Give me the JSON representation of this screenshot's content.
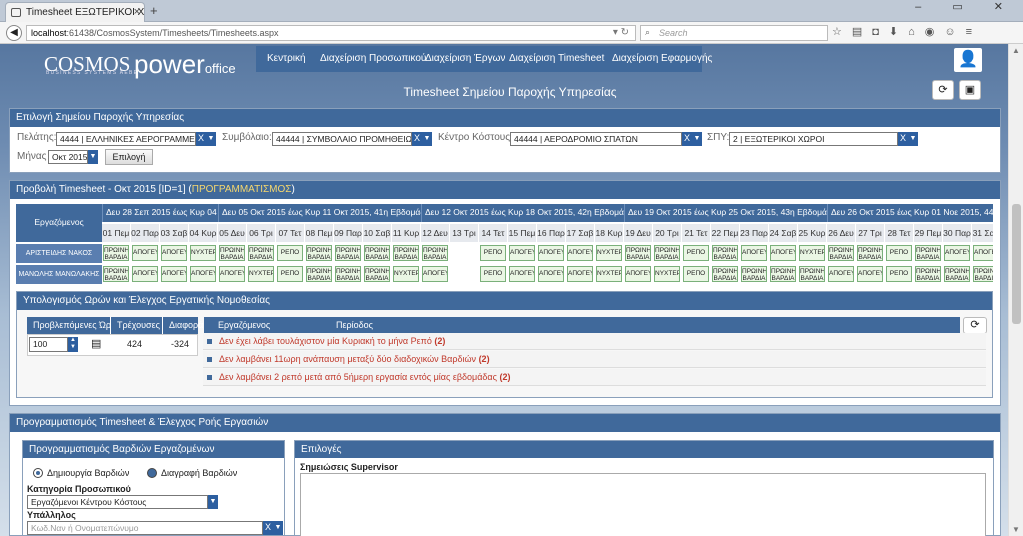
{
  "browser": {
    "tab_title": "Timesheet ΕΞΩΤΕΡΙΚΟΙ ΧΩ...",
    "new_tab": "+",
    "url_host": "localhost",
    "url_rest": ":61438/CosmosSystem/Timesheets/Timesheets.aspx",
    "search_placeholder": "Search",
    "window_controls": "– ▭ ✕",
    "toolbar_icons": [
      "star-icon",
      "reading-list-icon",
      "pocket-icon",
      "download-icon",
      "home-icon",
      "chat-icon",
      "sync-icon",
      "user-icon",
      "menu-icon"
    ]
  },
  "header": {
    "logo_main": "COSMOS",
    "logo_sub": "BUSINESS SYSTEMS AEBE",
    "logo_power": "power",
    "logo_office": "office",
    "menu": [
      "Κεντρική",
      "Διαχείριση Προσωπικού",
      "Διαχείριση Έργων",
      "Διαχείριση Timesheet",
      "Διαχείριση Εφαρμογής"
    ],
    "page_title": "Timesheet Σημείου Παροχής Υπηρεσίας"
  },
  "selection": {
    "title": "Επιλογή Σημείου Παροχής Υπηρεσίας",
    "client_label": "Πελάτης:",
    "client_value": "4444 | ΕΛΛΗΝΙΚΕΣ ΑΕΡΟΓΡΑΜΜΕΣ",
    "contract_label": "Συμβόλαιο:",
    "contract_value": "44444 | ΣΥΜΒΟΛΑΙΟ ΠΡΟΜΗΘΕΙΩΝ",
    "costcenter_label": "Κέντρο Κόστους:",
    "costcenter_value": "44444 | ΑΕΡΟΔΡΟΜΙΟ ΣΠΑΤΩΝ",
    "spy_label": "ΣΠΥ:",
    "spy_value": "2 | ΕΞΩΤΕΡΙΚΟΙ ΧΩΡΟΙ",
    "month_label": "Μήνας",
    "month_value": "Οκτ 2015",
    "select_button": "Επιλογή",
    "x": "X"
  },
  "timesheet": {
    "title_prefix": "Προβολή Timesheet - Οκτ 2015 [ID=1] (",
    "title_status": "ΠΡΟΓΡΑΜΜΑΤΙΣΜΟΣ",
    "title_suffix": ")",
    "employee_header": "Εργαζόμενος",
    "weeks": [
      "Δευ 28 Σεπ 2015 έως Κυρ 04 Οκτ",
      "Δευ 05 Οκτ 2015 έως Κυρ 11 Οκτ 2015, 41η Εβδομάδα",
      "Δευ 12 Οκτ 2015 έως Κυρ 18 Οκτ 2015, 42η Εβδομάδα",
      "Δευ 19 Οκτ 2015 έως Κυρ 25 Οκτ 2015, 43η Εβδομάδα",
      "Δευ 26 Οκτ 2015 έως Κυρ 01 Νοε 2015, 44η Εβδ"
    ],
    "days": [
      "01 Πεμ",
      "02 Παρ",
      "03 Σαβ",
      "04 Κυρ",
      "05 Δευ",
      "06 Τρι",
      "07 Τετ",
      "08 Πεμ",
      "09 Παρ",
      "10 Σαβ",
      "11 Κυρ",
      "12 Δευ",
      "13 Τρι",
      "14 Τετ",
      "15 Πεμ",
      "16 Παρ",
      "17 Σαβ",
      "18 Κυρ",
      "19 Δευ",
      "20 Τρι",
      "21 Τετ",
      "22 Πεμ",
      "23 Παρ",
      "24 Σαβ",
      "25 Κυρ",
      "26 Δευ",
      "27 Τρι",
      "28 Τετ",
      "29 Πεμ",
      "30 Παρ",
      "31 Σαβ"
    ],
    "rows": [
      {
        "employee": "ΑΡΙΣΤΕΙΔΗΣ ΝΑΚΟΣ",
        "shifts": [
          "ΠΡΩΙΝΗ ΒΑΡΔΙΑ",
          "ΑΠΟΓΕΥ",
          "ΑΠΟΓΕΥ",
          "ΝΥΧΤΕΡΙ",
          "ΠΡΩΙΝΗ ΒΑΡΔΙΑ",
          "ΠΡΩΙΝΗ ΒΑΡΔΙΑ",
          "ΡΕΠΟ",
          "ΠΡΩΙΝΗ ΒΑΡΔΙΑ",
          "ΠΡΩΙΝΗ ΒΑΡΔΙΑ",
          "ΠΡΩΙΝΗ ΒΑΡΔΙΑ",
          "ΠΡΩΙΝΗ ΒΑΡΔΙΑ",
          "ΠΡΩΙΝΗ ΒΑΡΔΙΑ",
          "",
          "ΡΕΠΟ",
          "ΑΠΟΓΕΥ",
          "ΑΠΟΓΕΥ",
          "ΑΠΟΓΕΥ",
          "ΝΥΧΤΕΡΙ",
          "ΠΡΩΙΝΗ ΒΑΡΔΙΑ",
          "ΠΡΩΙΝΗ ΒΑΡΔΙΑ",
          "ΡΕΠΟ",
          "ΠΡΩΙΝΗ ΒΑΡΔΙΑ",
          "ΑΠΟΓΕΥ",
          "ΑΠΟΓΕΥ",
          "ΝΥΧΤΕΡΙ",
          "ΠΡΩΙΝΗ ΒΑΡΔΙΑ",
          "ΠΡΩΙΝΗ ΒΑΡΔΙΑ",
          "ΡΕΠΟ",
          "ΠΡΩΙΝΗ ΒΑΡΔΙΑ",
          "ΑΠΟΓΕΥ",
          "ΑΠΟΓΕΥ"
        ]
      },
      {
        "employee": "ΜΑΝΩΛΗΣ ΜΑΝΩΛΑΚΗΣ",
        "shifts": [
          "ΠΡΩΙΝΗ ΒΑΡΔΙΑ",
          "ΑΠΟΓΕΥ",
          "ΑΠΟΓΕΥ",
          "ΑΠΟΓΕΥ",
          "ΑΠΟΓΕΥ",
          "ΝΥΧΤΕΡΙ",
          "ΡΕΠΟ",
          "ΠΡΩΙΝΗ ΒΑΡΔΙΑ",
          "ΠΡΩΙΝΗ ΒΑΡΔΙΑ",
          "ΠΡΩΙΝΗ ΒΑΡΔΙΑ",
          "ΝΥΧΤΕΡΙ",
          "ΑΠΟΓΕΥ",
          "",
          "ΡΕΠΟ",
          "ΑΠΟΓΕΥ",
          "ΑΠΟΓΕΥ",
          "ΑΠΟΓΕΥ",
          "ΝΥΧΤΕΡΙ",
          "ΑΠΟΓΕΥ",
          "ΝΥΧΤΕΡΙ",
          "ΡΕΠΟ",
          "ΠΡΩΙΝΗ ΒΑΡΔΙΑ",
          "ΠΡΩΙΝΗ ΒΑΡΔΙΑ",
          "ΠΡΩΙΝΗ ΒΑΡΔΙΑ",
          "ΠΡΩΙΝΗ ΒΑΡΔΙΑ",
          "ΑΠΟΓΕΥ",
          "ΑΠΟΓΕΥ",
          "ΡΕΠΟ",
          "ΠΡΩΙΝΗ ΒΑΡΔΙΑ",
          "ΠΡΩΙΝΗ ΒΑΡΔΙΑ",
          "ΠΡΩΙΝΗ ΒΑΡΔΙΑ"
        ]
      }
    ]
  },
  "calc": {
    "title": "Υπολογισμός Ωρών και Έλεγχος Εργατικής Νομοθεσίας",
    "col_expected": "Προβλεπόμενες Ώρες",
    "col_current": "Τρέχουσες",
    "col_diff": "Διαφορά",
    "expected_value": "100",
    "current_value": "424",
    "diff_value": "-324",
    "col_employee": "Εργαζόμενος",
    "col_period": "Περίοδος",
    "violations": [
      {
        "text": "Δεν έχει λάβει τουλάχιστον μία Κυριακή το μήνα Ρεπό",
        "count": "(2)"
      },
      {
        "text": "Δεν λαμβάνει 11ωρη ανάπαυση μεταξύ δύο διαδοχικών Βαρδιών",
        "count": "(2)"
      },
      {
        "text": "Δεν λαμβάνει 2 ρεπό μετά από 5ήμερη εργασία εντός μίας εβδομάδας",
        "count": "(2)"
      }
    ]
  },
  "planning": {
    "title": "Προγραμματισμός Timesheet & Έλεγχος Ροής Εργασιών",
    "sub_title": "Προγραμματισμός Βαρδιών Εργαζομένων",
    "create_label": "Δημιουργία Βαρδιών",
    "delete_label": "Διαγραφή Βαρδιών",
    "category_label": "Κατηγορία Προσωπικού",
    "category_value": "Εργαζόμενοι Κέντρου Κόστους",
    "employee_label": "Υπάλληλος",
    "employee_placeholder": "Κωδ.Ναν ή Ονοματεπώνυμο",
    "options_title": "Επιλογές",
    "notes_label": "Σημειώσεις Supervisor"
  },
  "colors": {
    "header_blue": "#40699b",
    "status_yellow": "#f5d76e",
    "violation_red": "#c0392b",
    "cell_green": "#eaf6e4"
  }
}
